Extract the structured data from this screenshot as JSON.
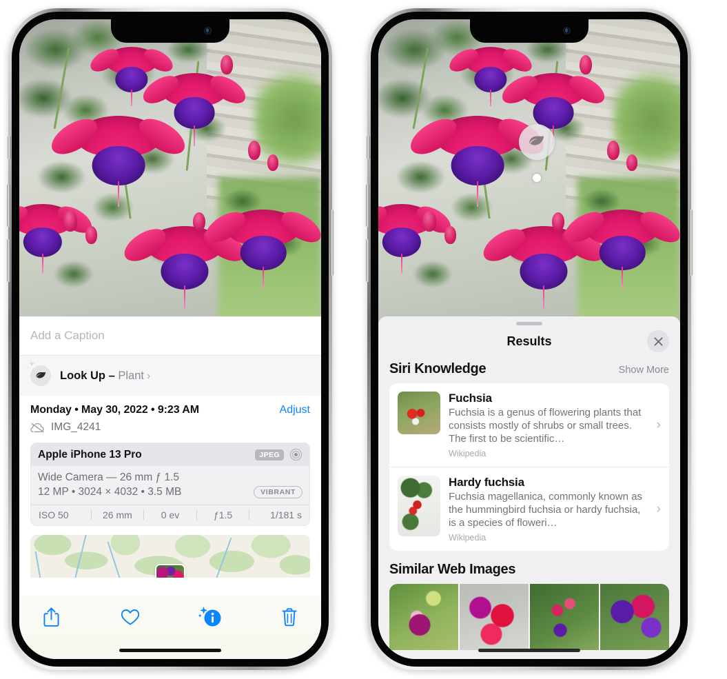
{
  "left_phone": {
    "caption": {
      "placeholder": "Add a Caption",
      "value": ""
    },
    "lookup": {
      "icon": "leaf-icon",
      "label": "Look Up",
      "dash": " – ",
      "subject": "Plant",
      "chevron": "›"
    },
    "info": {
      "date_line": "Monday • May 30, 2022 • 9:23 AM",
      "adjust_label": "Adjust",
      "cloud_icon": "icloud-slash-icon",
      "file_name": "IMG_4241"
    },
    "camera_card": {
      "device": "Apple iPhone 13 Pro",
      "format_badge": "JPEG",
      "aperture_icon": "aperture-icon",
      "lens_line": "Wide Camera — 26 mm ƒ 1.5",
      "spec_line": "12 MP • 3024 × 4032 • 3.5 MB",
      "quality_badge": "VIBRANT",
      "exif": [
        "ISO 50",
        "26 mm",
        "0 ev",
        "ƒ1.5",
        "1/181 s"
      ]
    },
    "toolbar": [
      {
        "name": "share-button",
        "icon": "share-icon"
      },
      {
        "name": "favorite-button",
        "icon": "heart-icon"
      },
      {
        "name": "info-button",
        "icon": "info-sparkle-icon"
      },
      {
        "name": "delete-button",
        "icon": "trash-icon"
      }
    ]
  },
  "right_phone": {
    "badge": {
      "icon": "leaf-icon"
    },
    "results": {
      "title": "Results",
      "close_icon": "close-icon",
      "sections": [
        {
          "title": "Siri Knowledge",
          "action": "Show More",
          "items": [
            {
              "title": "Fuchsia",
              "description": "Fuchsia is a genus of flowering plants that consists mostly of shrubs or small trees. The first to be scientific…",
              "source": "Wikipedia",
              "chevron": "›",
              "thumb": "fuchsia-red-flowers-thumb"
            },
            {
              "title": "Hardy fuchsia",
              "description": "Fuchsia magellanica, commonly known as the hummingbird fuchsia or hardy fuchsia, is a species of floweri…",
              "source": "Wikipedia",
              "chevron": "›",
              "thumb": "hardy-fuchsia-branch-thumb"
            }
          ]
        },
        {
          "title": "Similar Web Images",
          "images": [
            "fuchsia-pink-purple-leaves",
            "fuchsia-red-magenta-closeup",
            "fuchsia-bush-many-buds",
            "fuchsia-purple-red-cluster"
          ]
        }
      ]
    }
  },
  "colors": {
    "accent_blue": "#0a84ff",
    "sheet_bg": "#ffffff",
    "results_bg": "#f0f0f3",
    "muted_text": "#8c8c91"
  }
}
